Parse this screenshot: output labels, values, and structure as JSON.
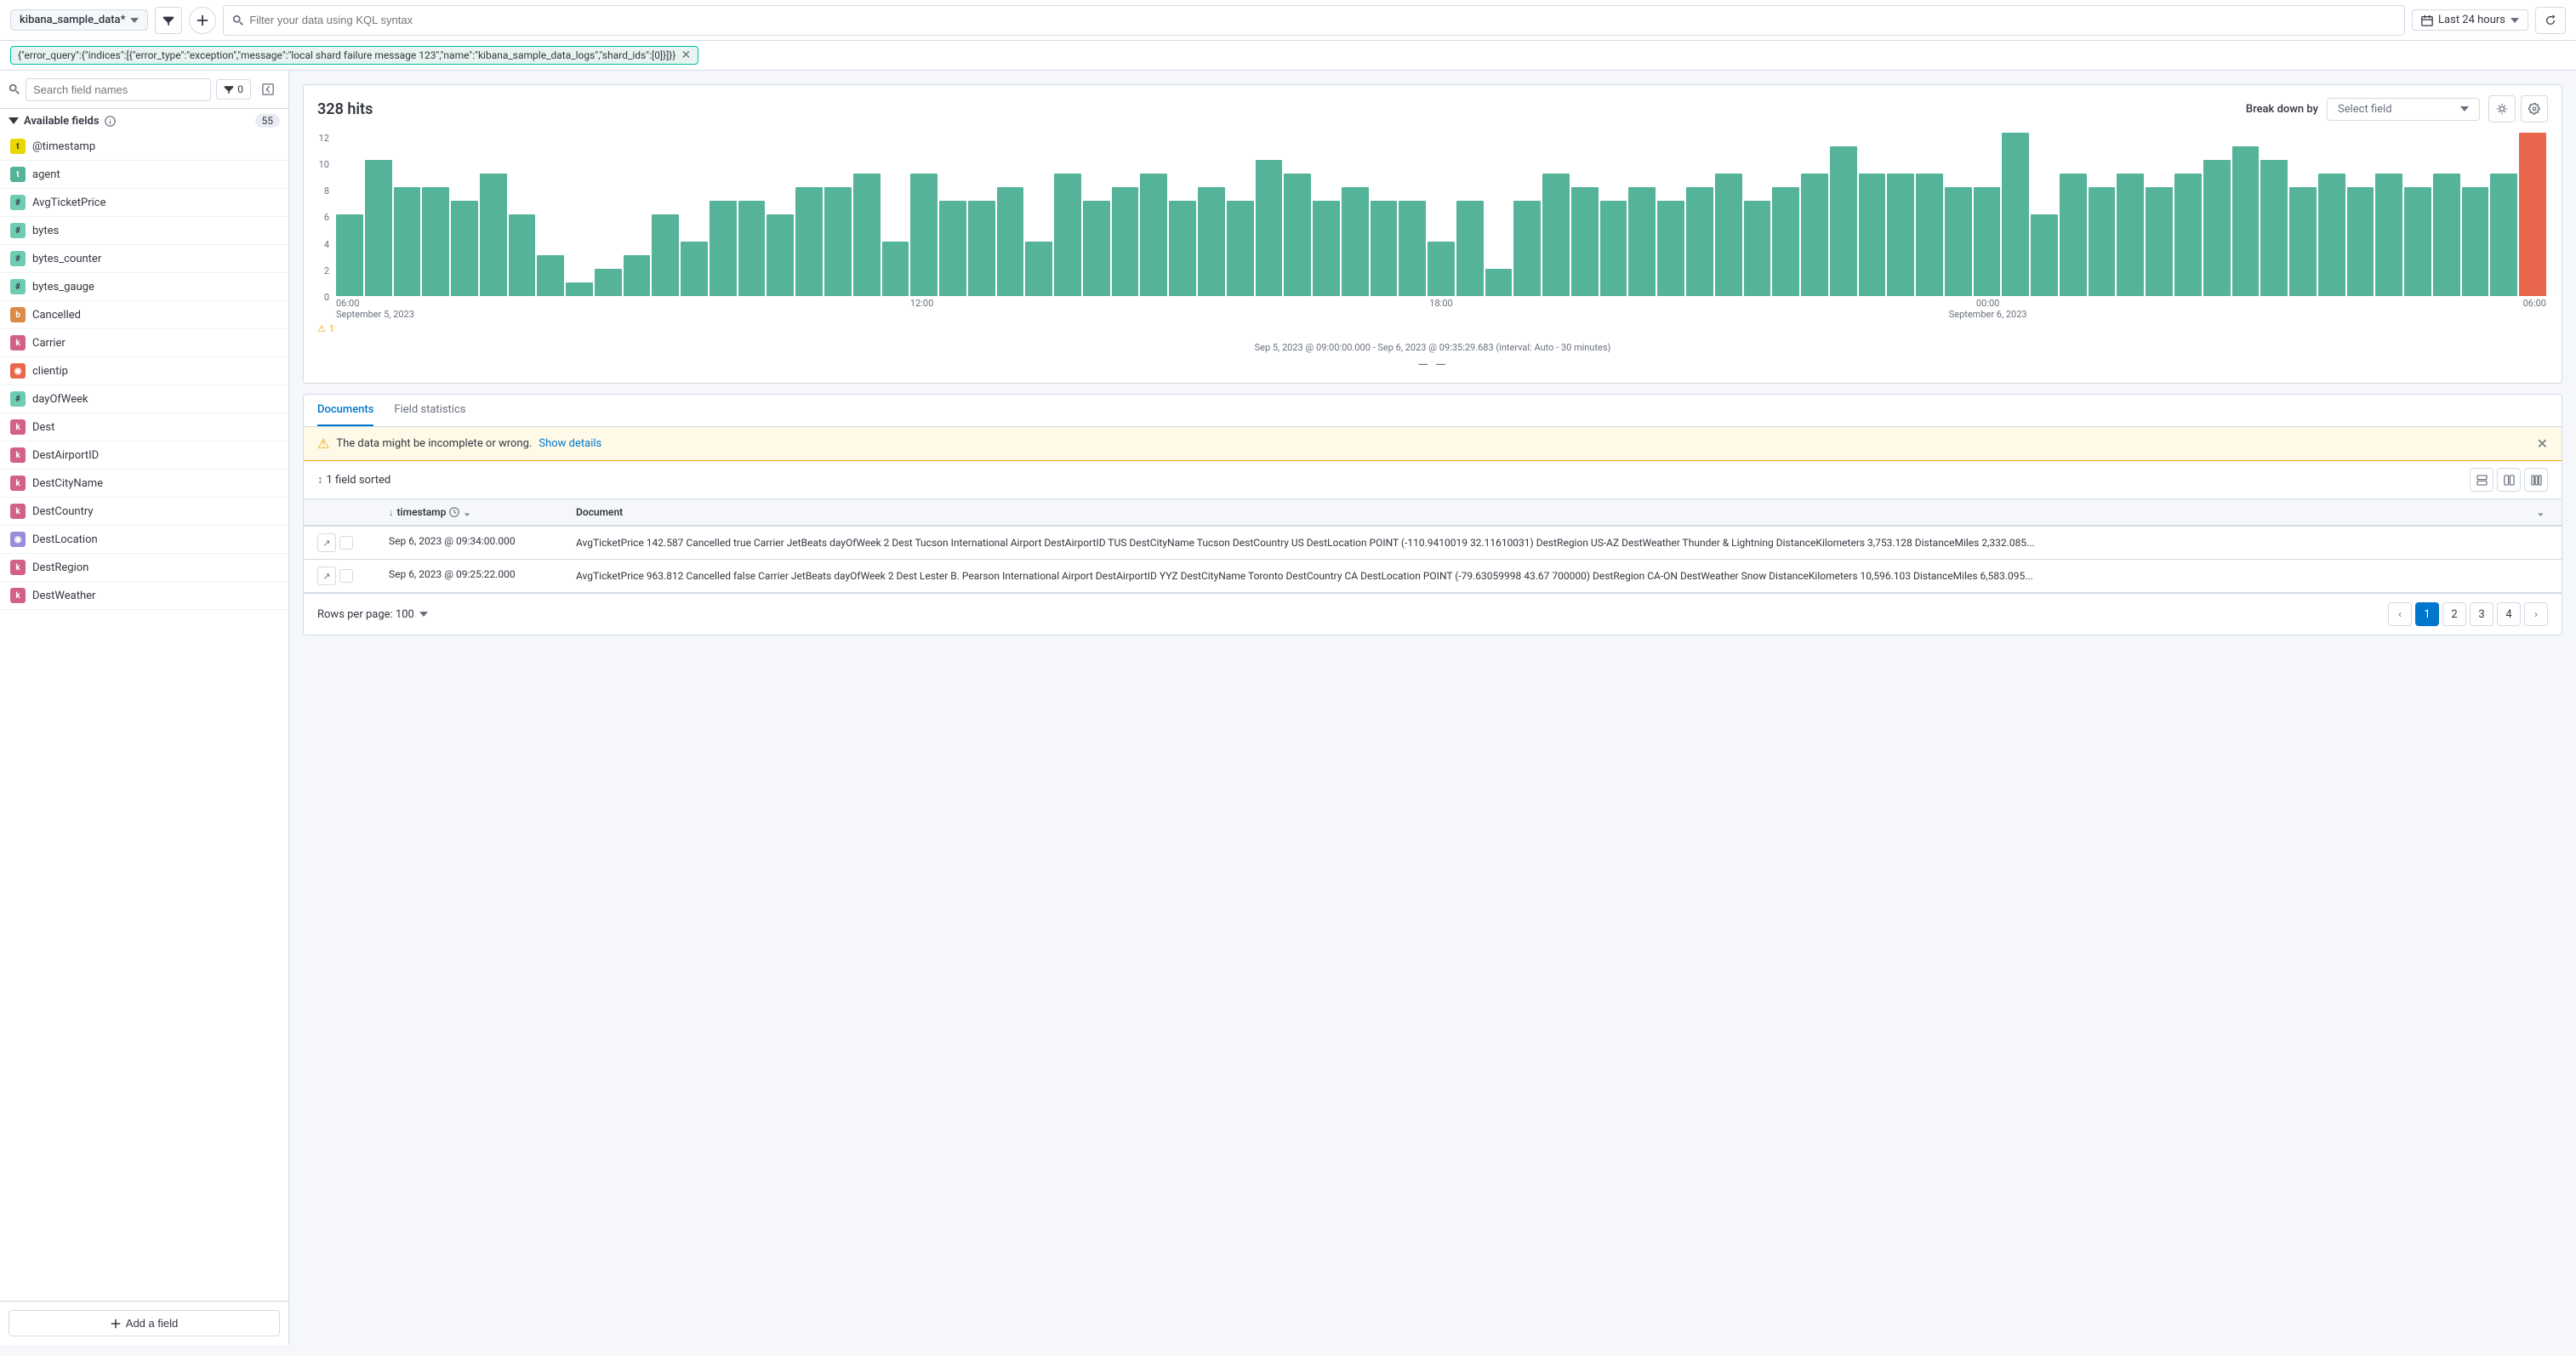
{
  "topbar": {
    "index_name": "kibana_sample_data*",
    "kql_placeholder": "Filter your data using KQL syntax",
    "time_label": "Last 24 hours",
    "filter_chip": "{\"error_query\":{\"indices\":[{\"error_type\":\"exception\",\"message\":\"local shard failure message 123\",\"name\":\"kibana_sample_data_logs\",\"shard_ids\":[0]}]}}"
  },
  "sidebar": {
    "search_placeholder": "Search field names",
    "filter_count": "0",
    "available_fields_label": "Available fields",
    "available_fields_count": "55",
    "add_field_label": "Add a field",
    "fields": [
      {
        "name": "@timestamp",
        "type": "date",
        "badge": "date"
      },
      {
        "name": "agent",
        "type": "text",
        "badge": "text"
      },
      {
        "name": "AvgTicketPrice",
        "type": "number",
        "badge": "number"
      },
      {
        "name": "bytes",
        "type": "number",
        "badge": "number"
      },
      {
        "name": "bytes_counter",
        "type": "number",
        "badge": "number"
      },
      {
        "name": "bytes_gauge",
        "type": "number",
        "badge": "number"
      },
      {
        "name": "Cancelled",
        "type": "boolean",
        "badge": "boolean"
      },
      {
        "name": "Carrier",
        "type": "keyword",
        "badge": "keyword"
      },
      {
        "name": "clientip",
        "type": "ip",
        "badge": "ip"
      },
      {
        "name": "dayOfWeek",
        "type": "number",
        "badge": "number"
      },
      {
        "name": "Dest",
        "type": "keyword",
        "badge": "keyword"
      },
      {
        "name": "DestAirportID",
        "type": "keyword",
        "badge": "keyword"
      },
      {
        "name": "DestCityName",
        "type": "keyword",
        "badge": "keyword"
      },
      {
        "name": "DestCountry",
        "type": "keyword",
        "badge": "keyword"
      },
      {
        "name": "DestLocation",
        "type": "geo",
        "badge": "geo"
      },
      {
        "name": "DestRegion",
        "type": "keyword",
        "badge": "keyword"
      },
      {
        "name": "DestWeather",
        "type": "keyword",
        "badge": "keyword"
      }
    ]
  },
  "histogram": {
    "hits": "328 hits",
    "breakdown_label": "Break down by",
    "select_field_placeholder": "Select field",
    "timestamp_range": "Sep 5, 2023 @ 09:00:00.000 - Sep 6, 2023 @ 09:35:29.683 (interval: Auto - 30 minutes)",
    "x_labels": [
      "06:00\nSeptember 5, 2023",
      "12:00",
      "18:00",
      "00:00\nSeptember 6, 2023",
      "06:00"
    ],
    "y_labels": [
      "12",
      "10",
      "8",
      "6",
      "4",
      "2",
      "0"
    ],
    "warning_text": "1",
    "bars": [
      6,
      10,
      8,
      8,
      7,
      9,
      6,
      3,
      1,
      2,
      3,
      6,
      4,
      7,
      7,
      6,
      8,
      8,
      9,
      4,
      9,
      7,
      7,
      8,
      4,
      9,
      7,
      8,
      9,
      7,
      8,
      7,
      10,
      9,
      7,
      8,
      7,
      7,
      4,
      7,
      2,
      7,
      9,
      8,
      7,
      8,
      7,
      8,
      9,
      7,
      8,
      9,
      11,
      9,
      9,
      9,
      8,
      8,
      12,
      6,
      9,
      8,
      9,
      8,
      9,
      10,
      11,
      10,
      8,
      9,
      8,
      9,
      8,
      9,
      8,
      9,
      12
    ]
  },
  "tabs": {
    "documents_label": "Documents",
    "field_statistics_label": "Field statistics"
  },
  "warning": {
    "text": "The data might be incomplete or wrong.",
    "link": "Show details"
  },
  "table": {
    "sort_info": "1 field sorted",
    "timestamp_col": "timestamp",
    "document_col": "Document",
    "rows_per_page": "Rows per page: 100",
    "rows": [
      {
        "timestamp": "Sep 6, 2023 @ 09:34:00.000",
        "document": "AvgTicketPrice 142.587  Cancelled true  Carrier JetBeats  dayOfWeek 2  Dest Tucson International Airport  DestAirportID TUS  DestCityName Tucson  DestCountry US  DestLocation POINT (-110.9410019 32.11610031)  DestRegion US-AZ  DestWeather Thunder & Lightning  DistanceKilometers 3,753.128  DistanceMiles 2,332.085..."
      },
      {
        "timestamp": "Sep 6, 2023 @ 09:25:22.000",
        "document": "AvgTicketPrice 963.812  Cancelled false  Carrier JetBeats  dayOfWeek 2  Dest Lester B. Pearson International Airport  DestAirportID YYZ  DestCityName Toronto  DestCountry CA  DestLocation POINT (-79.63059998 43.67 700000)  DestRegion CA-ON  DestWeather Snow  DistanceKilometers 10,596.103  DistanceMiles 6,583.095..."
      }
    ],
    "pagination": {
      "rows_per_page_label": "Rows per page: 100",
      "pages": [
        "1",
        "2",
        "3",
        "4"
      ]
    }
  }
}
